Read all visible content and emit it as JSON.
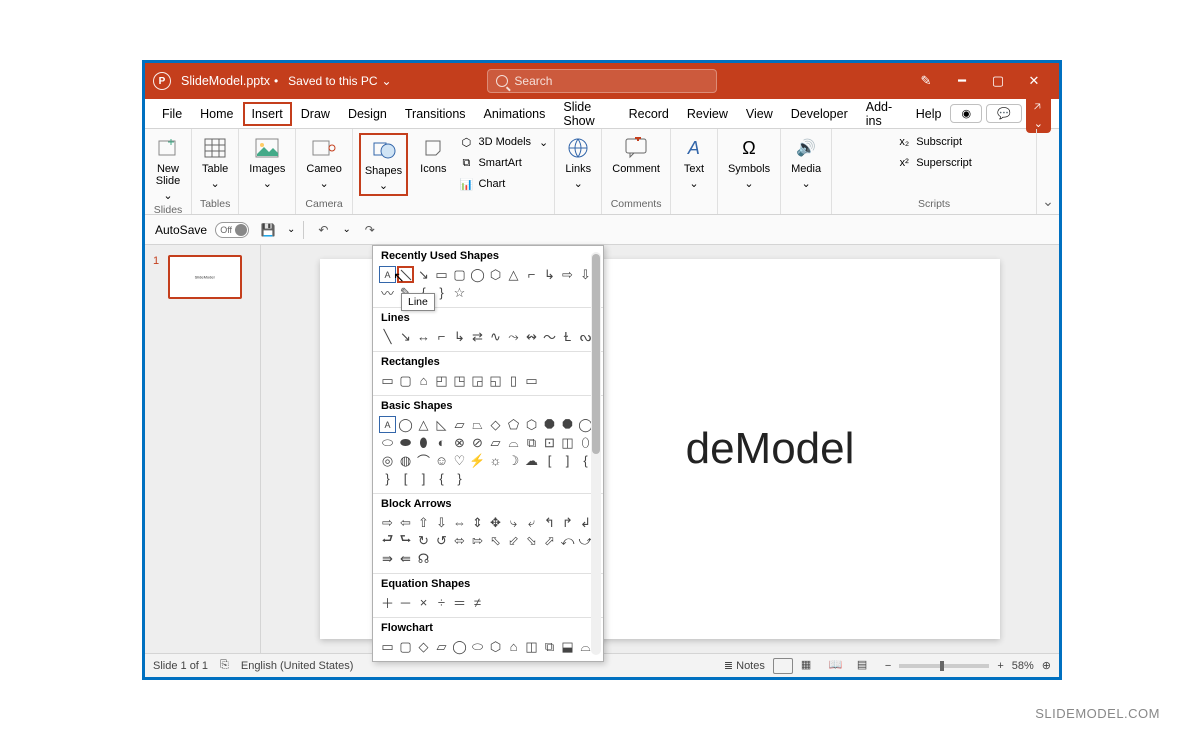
{
  "titlebar": {
    "filename": "SlideModel.pptx",
    "save_status": "Saved to this PC",
    "search_placeholder": "Search"
  },
  "tabs": {
    "file": "File",
    "home": "Home",
    "insert": "Insert",
    "draw": "Draw",
    "design": "Design",
    "transitions": "Transitions",
    "animations": "Animations",
    "slideshow": "Slide Show",
    "record": "Record",
    "review": "Review",
    "view": "View",
    "developer": "Developer",
    "addins": "Add-ins",
    "help": "Help"
  },
  "ribbon": {
    "new_slide": "New\nSlide",
    "table": "Table",
    "images": "Images",
    "cameo": "Cameo",
    "shapes": "Shapes",
    "icons": "Icons",
    "models3d": "3D Models",
    "smartart": "SmartArt",
    "chart": "Chart",
    "links": "Links",
    "comment": "Comment",
    "text": "Text",
    "symbols": "Symbols",
    "media": "Media",
    "subscript": "Subscript",
    "superscript": "Superscript",
    "group_slides": "Slides",
    "group_tables": "Tables",
    "group_camera": "Camera",
    "group_comments": "Comments",
    "group_scripts": "Scripts"
  },
  "qat": {
    "autosave": "AutoSave",
    "autosave_state": "Off"
  },
  "shapes_menu": {
    "recently_used": "Recently Used Shapes",
    "lines": "Lines",
    "rectangles": "Rectangles",
    "basic": "Basic Shapes",
    "block_arrows": "Block Arrows",
    "equation": "Equation Shapes",
    "flowchart": "Flowchart",
    "tooltip": "Line"
  },
  "canvas": {
    "visible_text": "deModel"
  },
  "thumb": {
    "number": "1",
    "tiny_text": "SlideModel"
  },
  "status": {
    "slide_info": "Slide 1 of 1",
    "language": "English (United States)",
    "notes": "Notes",
    "zoom": "58%"
  },
  "watermark": "SLIDEMODEL.COM"
}
